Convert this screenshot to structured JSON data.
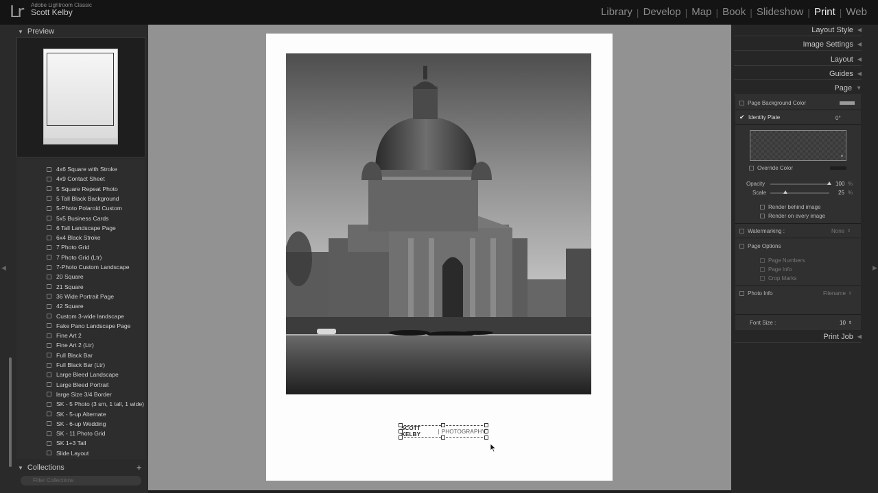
{
  "app": {
    "logo": "Lr",
    "name": "Adobe Lightroom Classic",
    "user": "Scott Kelby"
  },
  "modules": [
    {
      "label": "Library",
      "active": false
    },
    {
      "label": "Develop",
      "active": false
    },
    {
      "label": "Map",
      "active": false
    },
    {
      "label": "Book",
      "active": false
    },
    {
      "label": "Slideshow",
      "active": false
    },
    {
      "label": "Print",
      "active": true
    },
    {
      "label": "Web",
      "active": false
    }
  ],
  "left_panel": {
    "preview_label": "Preview",
    "templates": [
      "4x6 Square with Stroke",
      "4x9 Contact Sheet",
      "5 Square Repeat Photo",
      "5 Tall Black Background",
      "5-Photo Polaroid Custom",
      "5x5 Business Cards",
      "6 Tall Landscape Page",
      "6x4 Black Stroke",
      "7 Photo Grid",
      "7 Photo Grid (Ltr)",
      "7-Photo Custom Landscape",
      "20 Square",
      "21 Square",
      "36 Wide Portrait Page",
      "42 Square",
      "Custom 3-wide landscape",
      "Fake Pano Landscape Page",
      "Fine Art 2",
      "Fine Art 2 (Ltr)",
      "Full Black Bar",
      "Full Black Bar (Ltr)",
      "Large Bleed Landscape",
      "Large Bleed Portrait",
      "large Size 3/4 Border",
      "SK - 5 Photo (3 sm, 1 tall, 1 wide)",
      "SK - 5-up Alternate",
      "SK - 6-up Wedding",
      "SK - 11 Photo Grid",
      "SK 1+3 Tall",
      "Slide Layout"
    ],
    "collections_label": "Collections",
    "collections_add": "+",
    "filter_placeholder": "Filter Collections"
  },
  "canvas": {
    "identity_plate": {
      "name": "SCOTT KELBY",
      "divider": "|",
      "tagline": "PHOTOGRAPHY"
    }
  },
  "right_panel": {
    "sections": [
      "Layout Style",
      "Image Settings",
      "Layout",
      "Guides",
      "Page",
      "Print Job"
    ],
    "page": {
      "page_bg_color": "Page Background Color",
      "identity_plate": "Identity Plate",
      "identity_rotation": "0°",
      "override_color": "Override Color",
      "opacity_label": "Opacity",
      "opacity_value": "100",
      "opacity_unit": "%",
      "opacity_level": 1.0,
      "scale_label": "Scale",
      "scale_value": "25",
      "scale_unit": "%",
      "scale_level": 0.25,
      "render_behind": "Render behind image",
      "render_every": "Render on every image",
      "watermarking_label": "Watermarking :",
      "watermarking_value": "None",
      "page_options": "Page Options",
      "page_numbers": "Page Numbers",
      "page_info": "Page Info",
      "crop_marks": "Crop Marks",
      "photo_info": "Photo Info",
      "photo_info_value": "Filename",
      "font_size_label": "Font Size :",
      "font_size_value": "10"
    }
  }
}
